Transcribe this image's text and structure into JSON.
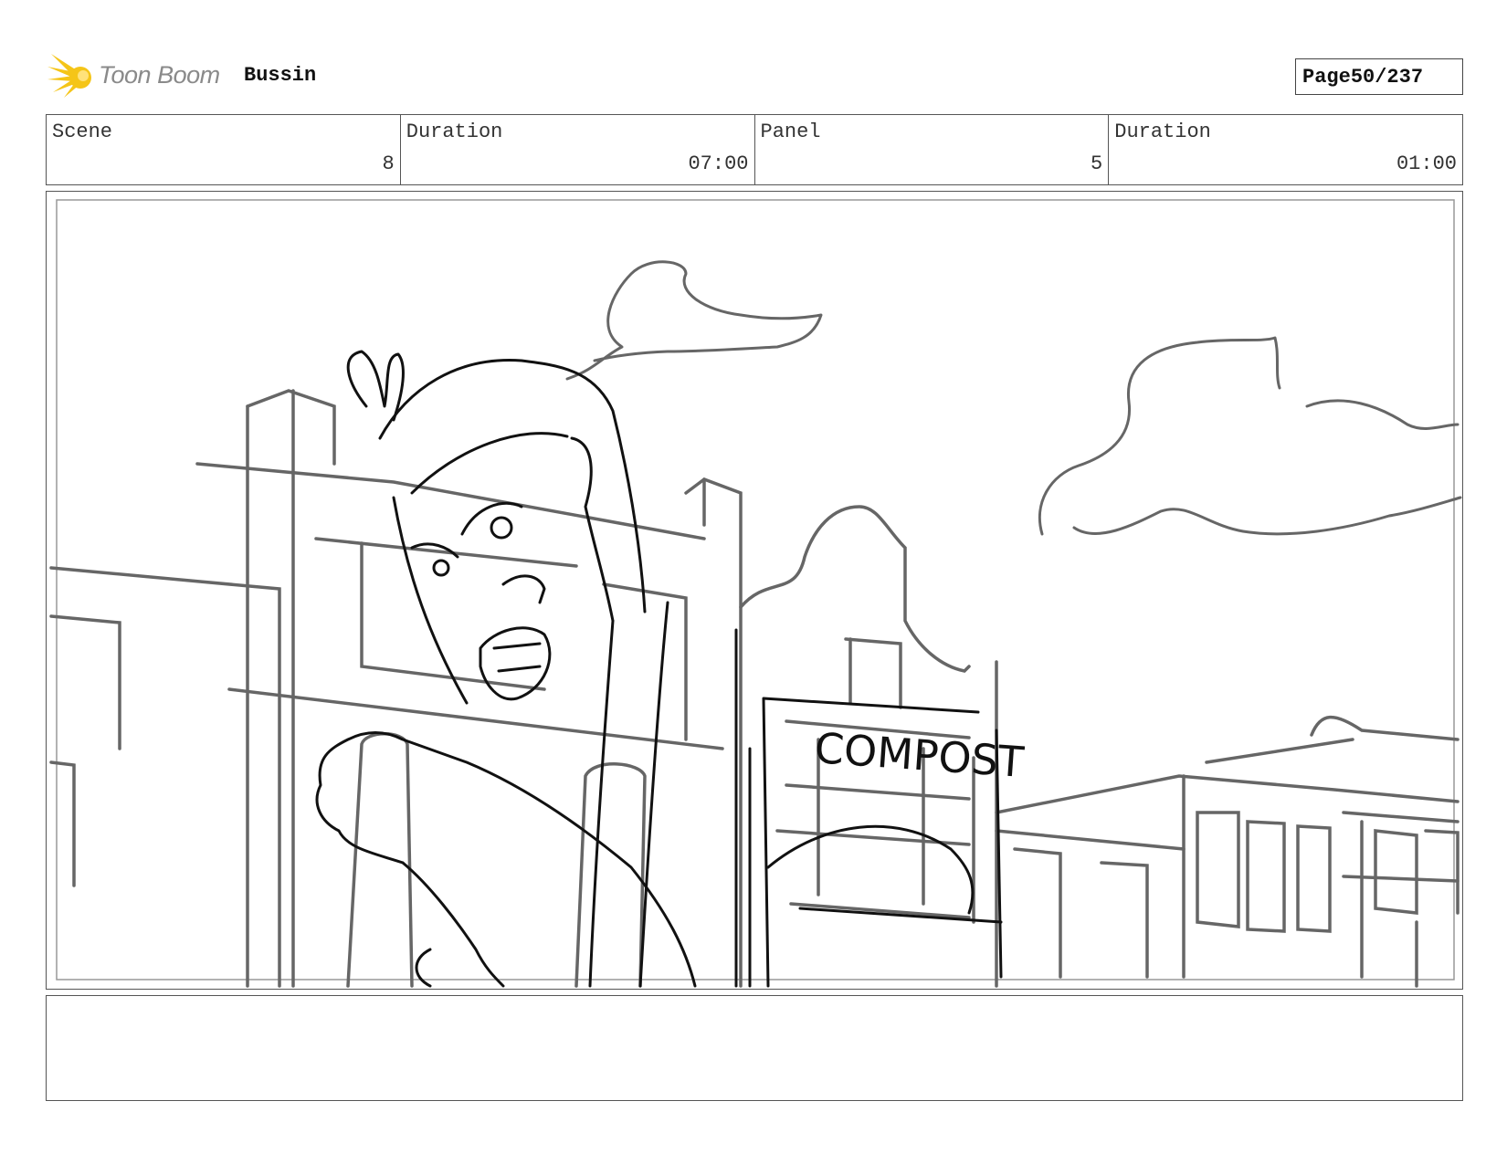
{
  "header": {
    "logo_text": "Toon Boom",
    "project_name": "Bussin",
    "page_label": "Page",
    "page_value": "50/237"
  },
  "info": {
    "scene_label": "Scene",
    "scene_value": "8",
    "scene_duration_label": "Duration",
    "scene_duration_value": "07:00",
    "panel_label": "Panel",
    "panel_value": "5",
    "panel_duration_label": "Duration",
    "panel_duration_value": "01:00"
  },
  "artwork": {
    "sign_text": "COMPOST"
  },
  "notes": {
    "text": ""
  },
  "colors": {
    "logo_yellow": "#f5c518",
    "sketch_dark": "#111111",
    "sketch_gray": "#666666"
  }
}
